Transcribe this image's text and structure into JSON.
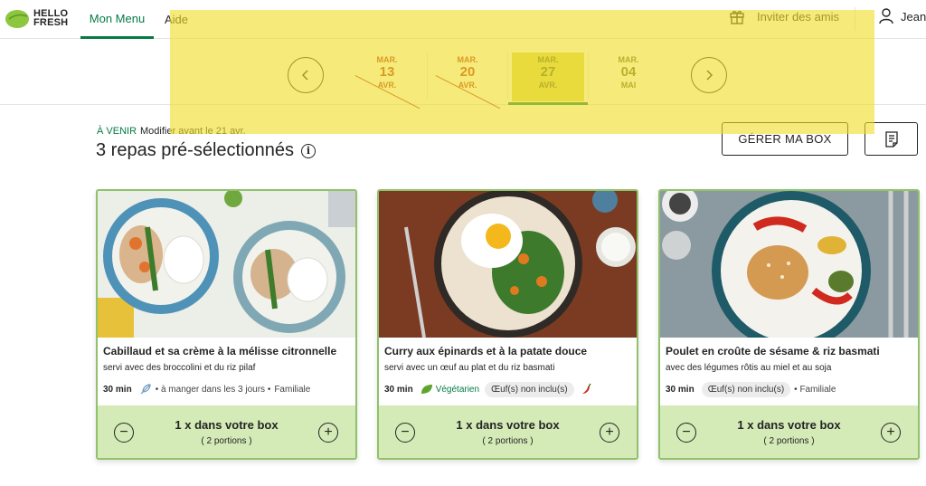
{
  "brand": {
    "logo_line1": "HELLO",
    "logo_line2": "FRESH"
  },
  "nav": {
    "menu": "Mon Menu",
    "help": "Aide",
    "invite": "Inviter des amis",
    "user": "Jean-"
  },
  "weeks": [
    {
      "dow": "MAR.",
      "day": "13",
      "month": "AVR.",
      "state": "past"
    },
    {
      "dow": "MAR.",
      "day": "20",
      "month": "AVR.",
      "state": "past"
    },
    {
      "dow": "MAR.",
      "day": "27",
      "month": "AVR.",
      "state": "current"
    },
    {
      "dow": "MAR.",
      "day": "04",
      "month": "MAI",
      "state": "future"
    }
  ],
  "section": {
    "status_tag": "À VENIR",
    "deadline": "Modifier avant le 21 avr.",
    "title": "3 repas pré-sélectionnés",
    "manage_button": "GÉRER MA BOX"
  },
  "recipes": [
    {
      "name": "Cabillaud et sa crème à la mélisse citronnelle",
      "subtitle": "servi avec des broccolini et du riz pilaf",
      "time": "30 min",
      "tag_fresh": "à manger dans les 3 jours",
      "tag_family": "Familiale",
      "quantity": "1 x dans votre box",
      "portions": "( 2 portions )"
    },
    {
      "name": "Curry aux épinards et à la patate douce",
      "subtitle": "servi avec un œuf au plat et du riz basmati",
      "time": "30 min",
      "tag_veg": "Végétarien",
      "tag_egg": "Œuf(s) non inclu(s)",
      "quantity": "1 x dans votre box",
      "portions": "( 2 portions )"
    },
    {
      "name": "Poulet en croûte de sésame & riz basmati",
      "subtitle": "avec des légumes rôtis au miel et au soja",
      "time": "30 min",
      "tag_egg": "Œuf(s) non inclu(s)",
      "tag_family": "Familiale",
      "quantity": "1 x dans votre box",
      "portions": "( 2 portions )"
    }
  ],
  "icons": {
    "prev": "chevron-left-icon",
    "next": "chevron-right-icon",
    "gift": "gift-icon",
    "user": "user-icon",
    "info": "info-icon",
    "notes": "notes-icon",
    "minus": "minus-circle-icon",
    "plus": "plus-circle-icon",
    "leaf": "leaf-icon",
    "feather": "feather-icon",
    "chili": "chili-icon"
  },
  "colors": {
    "brand_green": "#067a46",
    "light_green": "#d4ebb7",
    "card_border": "#91c16a",
    "past_red": "#b22b1f",
    "highlight": "#f0de28"
  }
}
